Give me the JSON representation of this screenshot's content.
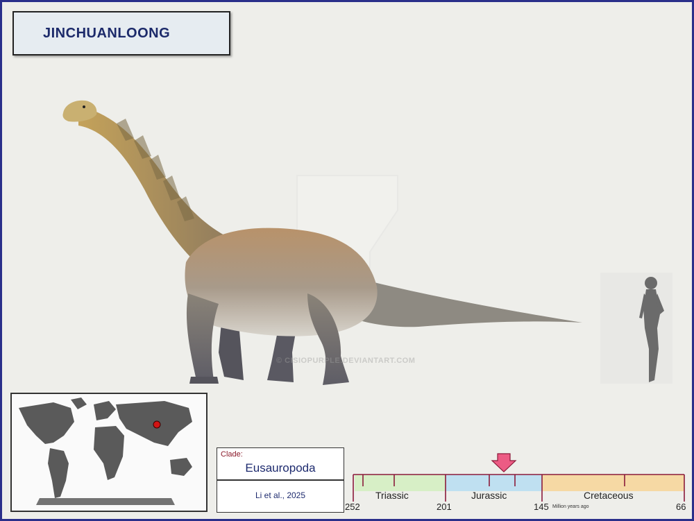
{
  "title": "JINCHUANLOONG",
  "watermark": "© CISIOPURPLE.DEVIANTART.COM",
  "clade": {
    "label": "Clade:",
    "name": "Eusauropoda",
    "reference": "Li et al., 2025"
  },
  "timeline": {
    "periods": [
      {
        "name": "Triassic",
        "color": "#d7efc6"
      },
      {
        "name": "Jurassic",
        "color": "#bfe0f1"
      },
      {
        "name": "Cretaceous",
        "color": "#f6d9a4"
      }
    ],
    "ticks": [
      "252",
      "201",
      "145",
      "66"
    ],
    "unit": "Million years ago",
    "line_color": "#8b1a3a",
    "arrow_color": "#ec5b84"
  },
  "map": {
    "land_color": "#5a5a5a",
    "marker_color": "#d21414"
  },
  "icons": [
    "world-map-icon",
    "location-marker-icon",
    "timeline-arrow-icon",
    "human-silhouette-icon"
  ]
}
